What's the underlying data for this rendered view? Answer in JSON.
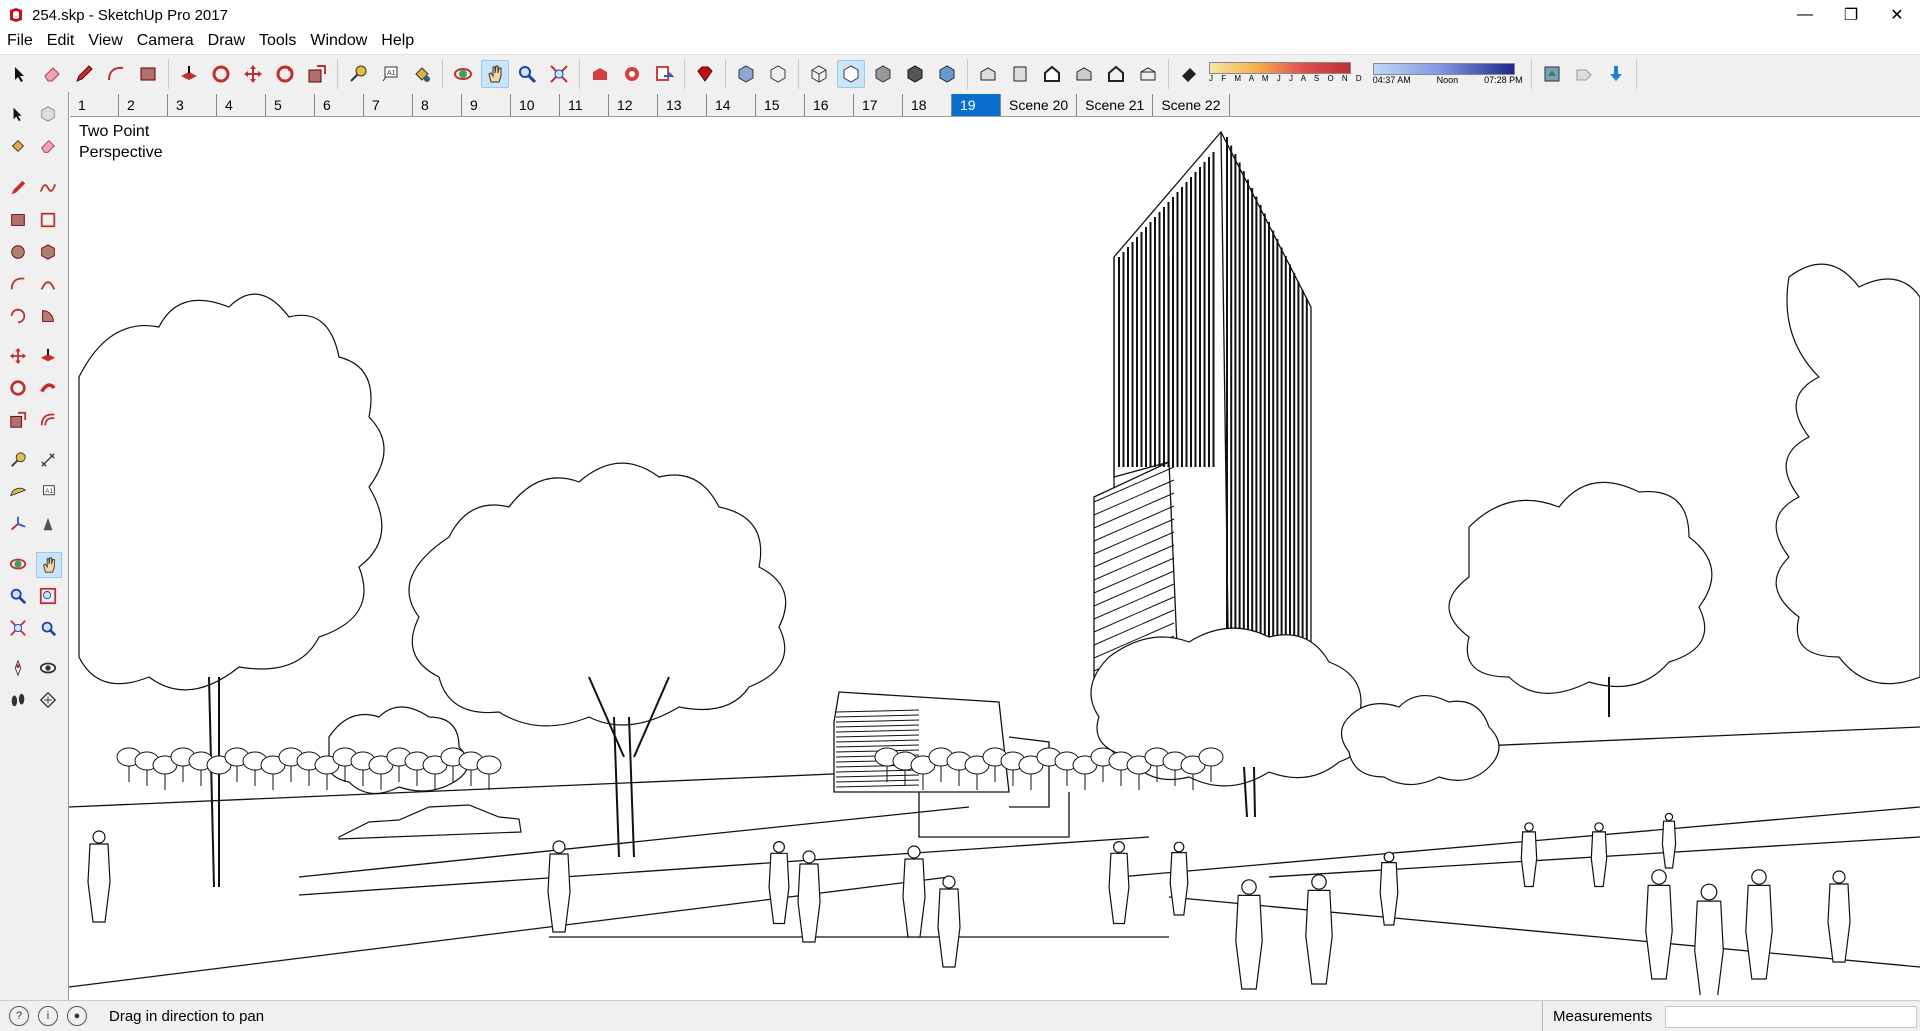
{
  "window": {
    "title": "254.skp - SketchUp Pro 2017",
    "minimize_glyph": "—",
    "restore_glyph": "❐",
    "close_glyph": "✕",
    "accent": "#d01010"
  },
  "menu": [
    "File",
    "Edit",
    "View",
    "Camera",
    "Draw",
    "Tools",
    "Window",
    "Help"
  ],
  "shadow": {
    "months": "J F M A M J J A S O N D",
    "time_start": "04:37 AM",
    "time_mid": "Noon",
    "time_end": "07:28 PM"
  },
  "scenes": [
    "1",
    "2",
    "3",
    "4",
    "5",
    "6",
    "7",
    "8",
    "9",
    "10",
    "11",
    "12",
    "13",
    "14",
    "15",
    "16",
    "17",
    "18",
    "19",
    "Scene 20",
    "Scene 21",
    "Scene 22"
  ],
  "selected_scene": "19",
  "viewport": {
    "camera_line1": "Two Point",
    "camera_line2": "Perspective"
  },
  "status": {
    "hint": "Drag in direction to pan",
    "measurements_label": "Measurements",
    "measurements_value": ""
  },
  "toolbar_icons": [
    "select-icon",
    "eraser-icon",
    "pencil-icon",
    "arc-icon",
    "rectangle-icon",
    "pushpull-icon",
    "followme-icon",
    "move-icon",
    "rotate-icon",
    "scale-icon",
    "tape-icon",
    "text-icon",
    "paint-icon",
    "orbit-icon",
    "pan-icon",
    "zoom-icon",
    "zoom-extents-icon",
    "warehouse-icon",
    "extension-icon",
    "sendlayout-icon",
    "ruby-icon",
    "xray-icon",
    "backedges-icon",
    "wireframe-icon",
    "hiddenline-icon",
    "shaded-icon",
    "textured-icon",
    "monochrome-icon",
    "iso-icon",
    "top-icon",
    "front-icon",
    "right-icon",
    "back-icon",
    "left-icon",
    "shadows-icon"
  ]
}
